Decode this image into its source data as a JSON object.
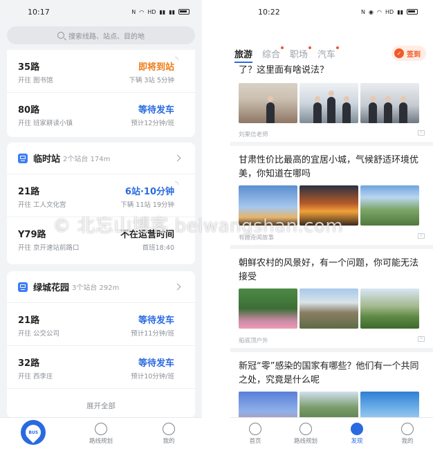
{
  "left": {
    "status": {
      "time": "10:17"
    },
    "search": {
      "placeholder": "搜索线路、站点、目的地"
    },
    "top_routes": [
      {
        "name": "35路",
        "dest": "开往 图书馆",
        "status": "即将到站",
        "sub": "下辆 3站 5分钟",
        "tone": "orange"
      },
      {
        "name": "80路",
        "dest": "开往 班家耕读小镇",
        "status": "等待发车",
        "sub": "预计12分钟/班",
        "tone": "blue"
      }
    ],
    "stop1": {
      "name": "临时站",
      "meta": "2个站台 174m",
      "routes": [
        {
          "name": "21路",
          "dest": "开往 工人文化宫",
          "status": "6站·10分钟",
          "sub": "下辆 11站 19分钟",
          "tone": "blue"
        },
        {
          "name": "Y79路",
          "dest": "开往 京开速站前路口",
          "status": "不在运营时间",
          "sub": "首班18:40",
          "tone": "black"
        }
      ]
    },
    "stop2": {
      "name": "绿城花园",
      "meta": "3个站台 292m",
      "routes": [
        {
          "name": "21路",
          "dest": "开往 公交公司",
          "status": "等待发车",
          "sub": "预计11分钟/班",
          "tone": "blue"
        },
        {
          "name": "32路",
          "dest": "开往 西李庄",
          "status": "等待发车",
          "sub": "预计10分钟/班",
          "tone": "blue"
        }
      ],
      "expand": "展开全部"
    },
    "tabs": {
      "bus_icon_text": "BUS",
      "route_plan": "路线规划",
      "mine": "我的"
    }
  },
  "right": {
    "status": {
      "time": "10:22"
    },
    "topics": [
      "旅游",
      "综合",
      "职场",
      "汽车"
    ],
    "signin": "签到",
    "articles": [
      {
        "title": "了？这里面有啥说法？",
        "source": "刘果信老师"
      },
      {
        "title": "甘肃性价比最高的宜居小城，气候舒适环境优美，你知道在哪吗",
        "source": "有趣奇闻故事"
      },
      {
        "title": "朝鲜农村的风景好，有一个问题，你可能无法接受",
        "source": "船底顶户外"
      },
      {
        "title": "新冠“零”感染的国家有哪些？他们有一个共同之处，究竟是什么呢",
        "source": ""
      }
    ],
    "tabs": {
      "home": "首页",
      "route_plan": "路线规划",
      "discover": "发现",
      "mine": "我的"
    }
  },
  "watermark": "© 北忘山博客 beiwangshan.com",
  "colors": {
    "accent_blue": "#2a6ae0",
    "orange": "#f07c1a",
    "red_dot": "#f0553a"
  }
}
